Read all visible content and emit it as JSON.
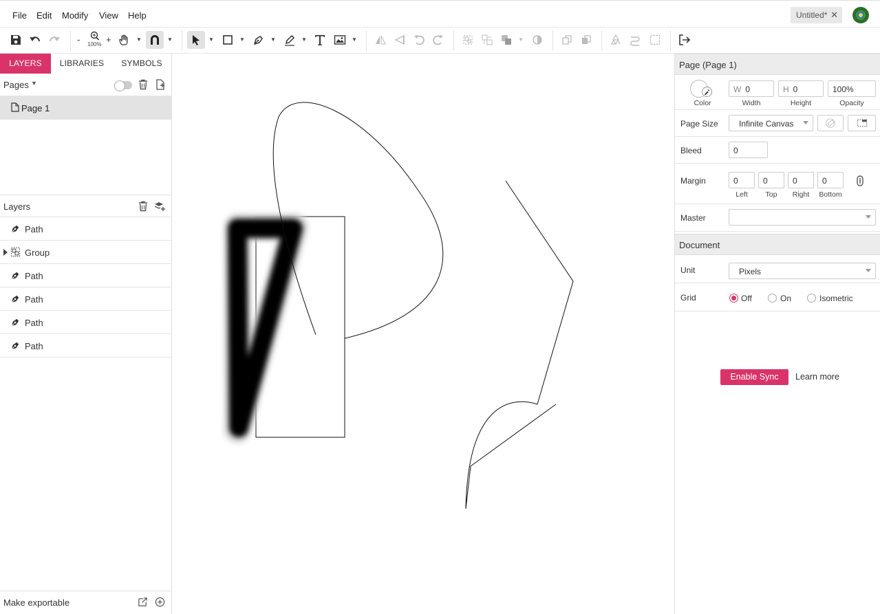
{
  "menu": {
    "items": [
      {
        "label": "File"
      },
      {
        "label": "Edit"
      },
      {
        "label": "Modify"
      },
      {
        "label": "View"
      },
      {
        "label": "Help"
      }
    ]
  },
  "document_tab": {
    "title": "Untitled*",
    "close": "✕"
  },
  "toolbar": {
    "zoom_minus": "-",
    "zoom_plus": "+",
    "zoom_level": "100%"
  },
  "left_panel": {
    "tabs": [
      {
        "label": "LAYERS",
        "active": true
      },
      {
        "label": "LIBRARIES",
        "active": false
      },
      {
        "label": "SYMBOLS",
        "active": false
      }
    ],
    "pages_label": "Pages",
    "pages": [
      {
        "label": "Page 1",
        "selected": true
      }
    ],
    "layers_label": "Layers",
    "layers": [
      {
        "label": "Path",
        "type": "path"
      },
      {
        "label": "Group",
        "type": "group"
      },
      {
        "label": "Path",
        "type": "path"
      },
      {
        "label": "Path",
        "type": "path"
      },
      {
        "label": "Path",
        "type": "path"
      },
      {
        "label": "Path",
        "type": "path"
      }
    ],
    "footer_label": "Make exportable"
  },
  "right_panel": {
    "page_header": "Page (Page 1)",
    "color_label": "Color",
    "width_prefix": "W",
    "width_value": "0",
    "width_label": "Width",
    "height_prefix": "H",
    "height_value": "0",
    "height_label": "Height",
    "opacity_value": "100%",
    "opacity_label": "Opacity",
    "page_size_label": "Page Size",
    "page_size_value": "Infinite Canvas",
    "bleed_label": "Bleed",
    "bleed_value": "0",
    "margin_label": "Margin",
    "margins": [
      {
        "value": "0",
        "label": "Left"
      },
      {
        "value": "0",
        "label": "Top"
      },
      {
        "value": "0",
        "label": "Right"
      },
      {
        "value": "0",
        "label": "Bottom"
      }
    ],
    "master_label": "Master",
    "master_value": "",
    "document_header": "Document",
    "unit_label": "Unit",
    "unit_value": "Pixels",
    "grid_label": "Grid",
    "grid_options": [
      {
        "label": "Off",
        "selected": true
      },
      {
        "label": "On",
        "selected": false
      },
      {
        "label": "Isometric",
        "selected": false
      }
    ],
    "sync_button": "Enable Sync",
    "learn_more": "Learn more"
  },
  "colors": {
    "accent": "#d9336a",
    "selected_row": "#e3e3e3",
    "section_header": "#ececec"
  }
}
